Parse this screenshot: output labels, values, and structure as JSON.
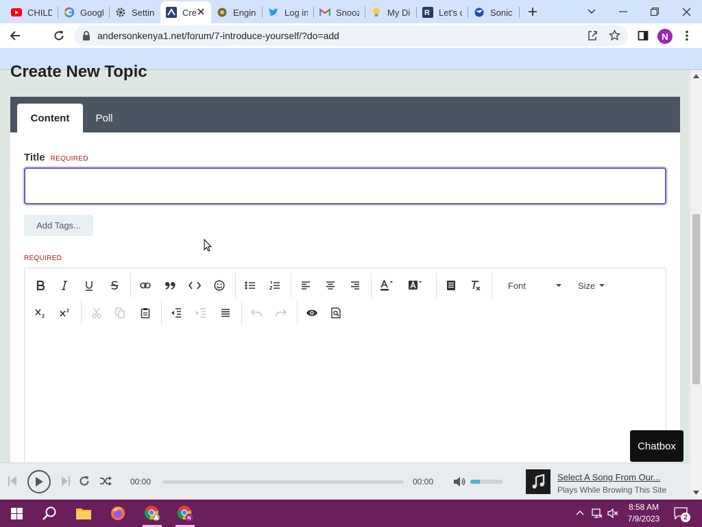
{
  "browser": {
    "tabs": [
      {
        "title": "CHILD",
        "icon": "youtube-icon"
      },
      {
        "title": "Googl",
        "icon": "google-icon"
      },
      {
        "title": "Setting",
        "icon": "gear-icon"
      },
      {
        "title": "Cre",
        "icon": "forum-icon",
        "active": true
      },
      {
        "title": "Engine",
        "icon": "engine-icon"
      },
      {
        "title": "Log in",
        "icon": "twitter-icon"
      },
      {
        "title": "Snooz",
        "icon": "gmail-icon"
      },
      {
        "title": "My Di",
        "icon": "lightbulb-icon"
      },
      {
        "title": "Let's c",
        "icon": "r-icon"
      },
      {
        "title": "Sonic",
        "icon": "sonic-icon"
      }
    ],
    "url": "andersonkenya1.net/forum/7-introduce-yourself/?do=add",
    "profile_initial": "N"
  },
  "page": {
    "heading": "Create New Topic",
    "tabs": {
      "content": "Content",
      "poll": "Poll"
    },
    "title_label": "Title",
    "required_label": "REQUIRED",
    "title_value": "",
    "add_tags_label": "Add Tags...",
    "editor": {
      "font_label": "Font",
      "size_label": "Size",
      "body": ""
    }
  },
  "chatbox_label": "Chatbox",
  "music": {
    "current_time": "00:00",
    "total_time": "00:00",
    "progress": 0,
    "volume": 0.3,
    "song_title": "Select A Song From Our...",
    "song_subtitle": "Plays While Browing This Site"
  },
  "taskbar": {
    "time": "8:58 AM",
    "date": "7/9/2023",
    "notification_count": "2"
  },
  "colors": {
    "accent": "#6b58b0",
    "tab_bar": "#4b5562",
    "required": "#a71d1d",
    "taskbar": "#6a1f5c"
  }
}
